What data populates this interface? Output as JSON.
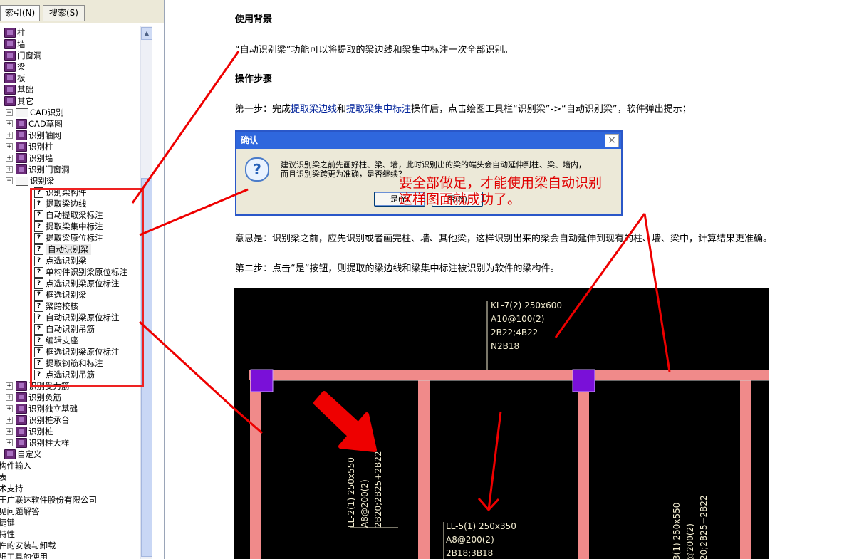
{
  "tabs": {
    "index": "索引(N)",
    "search": "搜索(S)"
  },
  "tree": [
    {
      "label": "柱",
      "icon": "book",
      "level": 0
    },
    {
      "label": "墙",
      "icon": "book",
      "level": 0
    },
    {
      "label": "门窗洞",
      "icon": "book",
      "level": 0
    },
    {
      "label": "梁",
      "icon": "book",
      "level": 0
    },
    {
      "label": "板",
      "icon": "book",
      "level": 0
    },
    {
      "label": "基础",
      "icon": "book",
      "level": 0
    },
    {
      "label": "其它",
      "icon": "book",
      "level": 0
    },
    {
      "label": "CAD识别",
      "icon": "open-book",
      "level": 0,
      "toggle": "−"
    },
    {
      "label": "CAD草图",
      "icon": "book",
      "level": 1,
      "toggle": "+"
    },
    {
      "label": "识别轴网",
      "icon": "book",
      "level": 1,
      "toggle": "+"
    },
    {
      "label": "识别柱",
      "icon": "book",
      "level": 1,
      "toggle": "+"
    },
    {
      "label": "识别墙",
      "icon": "book",
      "level": 1,
      "toggle": "+"
    },
    {
      "label": "识别门窗洞",
      "icon": "book",
      "level": 1,
      "toggle": "+"
    },
    {
      "label": "识别梁",
      "icon": "open-book",
      "level": 1,
      "toggle": "−"
    },
    {
      "label": "识别梁构件",
      "icon": "question",
      "level": 2
    },
    {
      "label": "提取梁边线",
      "icon": "question",
      "level": 2
    },
    {
      "label": "自动提取梁标注",
      "icon": "question",
      "level": 2
    },
    {
      "label": "提取梁集中标注",
      "icon": "question",
      "level": 2
    },
    {
      "label": "提取梁原位标注",
      "icon": "question",
      "level": 2
    },
    {
      "label": "自动识别梁",
      "icon": "question",
      "level": 2,
      "selected": true
    },
    {
      "label": "点选识别梁",
      "icon": "question",
      "level": 2
    },
    {
      "label": "单构件识别梁原位标注",
      "icon": "question",
      "level": 2
    },
    {
      "label": "点选识别梁原位标注",
      "icon": "question",
      "level": 2
    },
    {
      "label": "框选识别梁",
      "icon": "question",
      "level": 2
    },
    {
      "label": "梁跨校核",
      "icon": "question",
      "level": 2
    },
    {
      "label": "自动识别梁原位标注",
      "icon": "question",
      "level": 2
    },
    {
      "label": "自动识别吊筋",
      "icon": "question",
      "level": 2
    },
    {
      "label": "编辑支座",
      "icon": "question",
      "level": 2
    },
    {
      "label": "框选识别梁原位标注",
      "icon": "question",
      "level": 2
    },
    {
      "label": "提取钢筋和标注",
      "icon": "question",
      "level": 2
    },
    {
      "label": "点选识别吊筋",
      "icon": "question",
      "level": 2
    },
    {
      "label": "识别受力筋",
      "icon": "book",
      "level": 1,
      "toggle": "+"
    },
    {
      "label": "识别负筋",
      "icon": "book",
      "level": 1,
      "toggle": "+"
    },
    {
      "label": "识别独立基础",
      "icon": "book",
      "level": 1,
      "toggle": "+"
    },
    {
      "label": "识别桩承台",
      "icon": "book",
      "level": 1,
      "toggle": "+"
    },
    {
      "label": "识别桩",
      "icon": "book",
      "level": 1,
      "toggle": "+"
    },
    {
      "label": "识别柱大样",
      "icon": "book",
      "level": 1,
      "toggle": "+"
    },
    {
      "label": "自定义",
      "icon": "book",
      "level": 0
    },
    {
      "label": "构件输入",
      "icon": "none",
      "level": -1
    },
    {
      "label": "表",
      "icon": "none",
      "level": -1
    },
    {
      "label": "术支持",
      "icon": "none",
      "level": -1
    },
    {
      "label": "于广联达软件股份有限公司",
      "icon": "none",
      "level": -1
    },
    {
      "label": "见问题解答",
      "icon": "none",
      "level": -1
    },
    {
      "label": "捷键",
      "icon": "none",
      "level": -1
    },
    {
      "label": "特性",
      "icon": "none",
      "level": -1
    },
    {
      "label": "件的安装与卸载",
      "icon": "none",
      "level": -1
    },
    {
      "label": "细工具的使用",
      "icon": "none",
      "level": -1
    }
  ],
  "content": {
    "h_background": "使用背景",
    "p_background": "“自动识别梁”功能可以将提取的梁边线和梁集中标注一次全部识别。",
    "h_steps": "操作步骤",
    "step1_pre": "第一步：完成",
    "step1_link1": "提取梁边线",
    "step1_and": "和",
    "step1_link2": "提取梁集中标注",
    "step1_post": "操作后，点击绘图工具栏“识别梁”->“自动识别梁”，软件弹出提示；",
    "meaning": "意思是：识别梁之前，应先识别或者画完柱、墙、其他梁，这样识别出来的梁会自动延伸到现有的柱、墙、梁中，计算结果更准确。",
    "step2": "第二步：点击“是”按钮，则提取的梁边线和梁集中标注被识别为软件的梁构件。"
  },
  "dialog": {
    "title": "确认",
    "line1": "建议识别梁之前先画好柱、梁、墙，此时识别出的梁的端头会自动延伸到柱、梁、墙内，",
    "line2": "而且识别梁跨更为准确，是否继续？",
    "yes": "是(Y)",
    "no": "否(N)"
  },
  "annotation": {
    "line1": "要全部做足，才能使用梁自动识别",
    "line2": "这样图面就成功了。"
  },
  "cad": {
    "kl7": [
      "KL-7(2) 250x600",
      "A10@100(2)",
      "2B22;4B22",
      "N2B18"
    ],
    "ll5": [
      "LL-5(1) 250x350",
      "A8@200(2)",
      "2B18;3B18"
    ],
    "ll2": [
      "LL-2(1) 250x550",
      "A8@200(2)",
      "2B20;2B25+2B22"
    ],
    "right": [
      "3(1) 250x550",
      "@200(2)",
      "20;2B25+2B22"
    ]
  },
  "colors": {
    "beam": "#f08a8a",
    "column": "#7a10d8",
    "annotation": "#e00000",
    "cad_text": "#f2ecd0"
  }
}
